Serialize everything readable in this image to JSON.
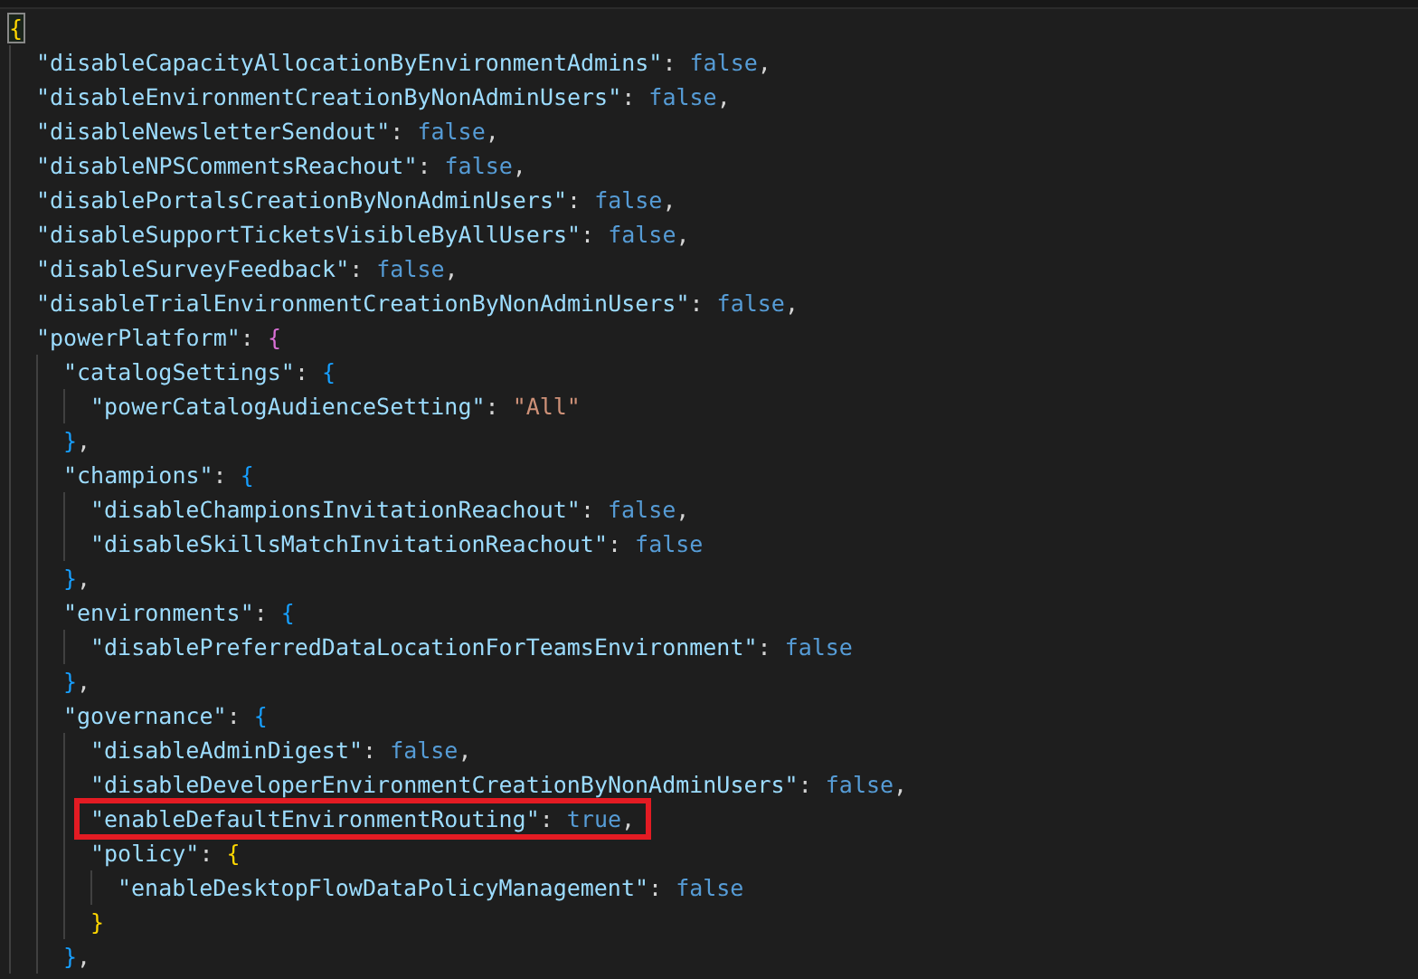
{
  "editor": {
    "document": {
      "bracket_matched": true,
      "tokens": [
        {
          "kind": "bracket",
          "text": "{"
        }
      ],
      "children": [
        {
          "tokens": [
            {
              "kind": "key",
              "text": "\"disableCapacityAllocationByEnvironmentAdmins\""
            },
            {
              "kind": "punct",
              "text": ": "
            },
            {
              "kind": "boolean",
              "text": "false"
            },
            {
              "kind": "punct",
              "text": ","
            }
          ]
        },
        {
          "tokens": [
            {
              "kind": "key",
              "text": "\"disableEnvironmentCreationByNonAdminUsers\""
            },
            {
              "kind": "punct",
              "text": ": "
            },
            {
              "kind": "boolean",
              "text": "false"
            },
            {
              "kind": "punct",
              "text": ","
            }
          ]
        },
        {
          "tokens": [
            {
              "kind": "key",
              "text": "\"disableNewsletterSendout\""
            },
            {
              "kind": "punct",
              "text": ": "
            },
            {
              "kind": "boolean",
              "text": "false"
            },
            {
              "kind": "punct",
              "text": ","
            }
          ]
        },
        {
          "tokens": [
            {
              "kind": "key",
              "text": "\"disableNPSCommentsReachout\""
            },
            {
              "kind": "punct",
              "text": ": "
            },
            {
              "kind": "boolean",
              "text": "false"
            },
            {
              "kind": "punct",
              "text": ","
            }
          ]
        },
        {
          "tokens": [
            {
              "kind": "key",
              "text": "\"disablePortalsCreationByNonAdminUsers\""
            },
            {
              "kind": "punct",
              "text": ": "
            },
            {
              "kind": "boolean",
              "text": "false"
            },
            {
              "kind": "punct",
              "text": ","
            }
          ]
        },
        {
          "tokens": [
            {
              "kind": "key",
              "text": "\"disableSupportTicketsVisibleByAllUsers\""
            },
            {
              "kind": "punct",
              "text": ": "
            },
            {
              "kind": "boolean",
              "text": "false"
            },
            {
              "kind": "punct",
              "text": ","
            }
          ]
        },
        {
          "tokens": [
            {
              "kind": "key",
              "text": "\"disableSurveyFeedback\""
            },
            {
              "kind": "punct",
              "text": ": "
            },
            {
              "kind": "boolean",
              "text": "false"
            },
            {
              "kind": "punct",
              "text": ","
            }
          ]
        },
        {
          "tokens": [
            {
              "kind": "key",
              "text": "\"disableTrialEnvironmentCreationByNonAdminUsers\""
            },
            {
              "kind": "punct",
              "text": ": "
            },
            {
              "kind": "boolean",
              "text": "false"
            },
            {
              "kind": "punct",
              "text": ","
            }
          ]
        },
        {
          "tokens": [
            {
              "kind": "key",
              "text": "\"powerPlatform\""
            },
            {
              "kind": "punct",
              "text": ": "
            },
            {
              "kind": "bracket",
              "text": "{"
            }
          ],
          "children": [
            {
              "tokens": [
                {
                  "kind": "key",
                  "text": "\"catalogSettings\""
                },
                {
                  "kind": "punct",
                  "text": ": "
                },
                {
                  "kind": "bracket",
                  "text": "{"
                }
              ],
              "children": [
                {
                  "tokens": [
                    {
                      "kind": "key",
                      "text": "\"powerCatalogAudienceSetting\""
                    },
                    {
                      "kind": "punct",
                      "text": ": "
                    },
                    {
                      "kind": "string",
                      "text": "\"All\""
                    }
                  ]
                }
              ],
              "close": [
                {
                  "kind": "bracket",
                  "text": "}"
                },
                {
                  "kind": "punct",
                  "text": ","
                }
              ]
            },
            {
              "tokens": [
                {
                  "kind": "key",
                  "text": "\"champions\""
                },
                {
                  "kind": "punct",
                  "text": ": "
                },
                {
                  "kind": "bracket",
                  "text": "{"
                }
              ],
              "children": [
                {
                  "tokens": [
                    {
                      "kind": "key",
                      "text": "\"disableChampionsInvitationReachout\""
                    },
                    {
                      "kind": "punct",
                      "text": ": "
                    },
                    {
                      "kind": "boolean",
                      "text": "false"
                    },
                    {
                      "kind": "punct",
                      "text": ","
                    }
                  ]
                },
                {
                  "tokens": [
                    {
                      "kind": "key",
                      "text": "\"disableSkillsMatchInvitationReachout\""
                    },
                    {
                      "kind": "punct",
                      "text": ": "
                    },
                    {
                      "kind": "boolean",
                      "text": "false"
                    }
                  ]
                }
              ],
              "close": [
                {
                  "kind": "bracket",
                  "text": "}"
                },
                {
                  "kind": "punct",
                  "text": ","
                }
              ]
            },
            {
              "tokens": [
                {
                  "kind": "key",
                  "text": "\"environments\""
                },
                {
                  "kind": "punct",
                  "text": ": "
                },
                {
                  "kind": "bracket",
                  "text": "{"
                }
              ],
              "children": [
                {
                  "tokens": [
                    {
                      "kind": "key",
                      "text": "\"disablePreferredDataLocationForTeamsEnvironment\""
                    },
                    {
                      "kind": "punct",
                      "text": ": "
                    },
                    {
                      "kind": "boolean",
                      "text": "false"
                    }
                  ]
                }
              ],
              "close": [
                {
                  "kind": "bracket",
                  "text": "}"
                },
                {
                  "kind": "punct",
                  "text": ","
                }
              ]
            },
            {
              "tokens": [
                {
                  "kind": "key",
                  "text": "\"governance\""
                },
                {
                  "kind": "punct",
                  "text": ": "
                },
                {
                  "kind": "bracket",
                  "text": "{"
                }
              ],
              "children": [
                {
                  "tokens": [
                    {
                      "kind": "key",
                      "text": "\"disableAdminDigest\""
                    },
                    {
                      "kind": "punct",
                      "text": ": "
                    },
                    {
                      "kind": "boolean",
                      "text": "false"
                    },
                    {
                      "kind": "punct",
                      "text": ","
                    }
                  ]
                },
                {
                  "tokens": [
                    {
                      "kind": "key",
                      "text": "\"disableDeveloperEnvironmentCreationByNonAdminUsers\""
                    },
                    {
                      "kind": "punct",
                      "text": ": "
                    },
                    {
                      "kind": "boolean",
                      "text": "false"
                    },
                    {
                      "kind": "punct",
                      "text": ","
                    }
                  ]
                },
                {
                  "highlighted": true,
                  "tokens": [
                    {
                      "kind": "key",
                      "text": "\"enableDefaultEnvironmentRouting\""
                    },
                    {
                      "kind": "punct",
                      "text": ": "
                    },
                    {
                      "kind": "boolean",
                      "text": "true"
                    },
                    {
                      "kind": "punct",
                      "text": ","
                    }
                  ]
                },
                {
                  "tokens": [
                    {
                      "kind": "key",
                      "text": "\"policy\""
                    },
                    {
                      "kind": "punct",
                      "text": ": "
                    },
                    {
                      "kind": "bracket",
                      "text": "{"
                    }
                  ],
                  "children": [
                    {
                      "tokens": [
                        {
                          "kind": "key",
                          "text": "\"enableDesktopFlowDataPolicyManagement\""
                        },
                        {
                          "kind": "punct",
                          "text": ": "
                        },
                        {
                          "kind": "boolean",
                          "text": "false"
                        }
                      ]
                    }
                  ],
                  "close": [
                    {
                      "kind": "bracket",
                      "text": "}"
                    }
                  ]
                }
              ],
              "close": [
                {
                  "kind": "bracket",
                  "text": "}"
                },
                {
                  "kind": "punct",
                  "text": ","
                }
              ]
            }
          ]
        }
      ]
    }
  }
}
